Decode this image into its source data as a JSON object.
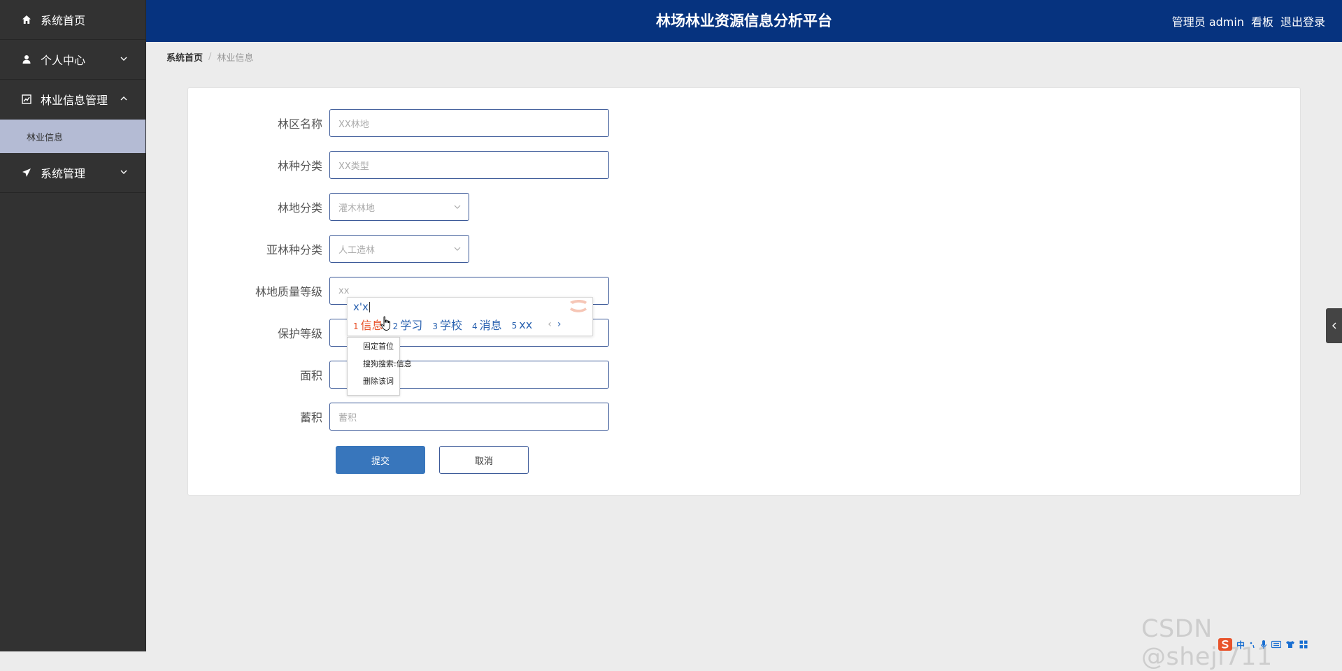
{
  "app": {
    "title": "林场林业资源信息分析平台",
    "header_links": {
      "user": "管理员 admin",
      "dashboard": "看板",
      "logout": "退出登录"
    }
  },
  "sidebar": {
    "items": [
      {
        "label": "系统首页",
        "icon": "home-icon"
      },
      {
        "label": "个人中心",
        "icon": "user-icon",
        "expanded": false
      },
      {
        "label": "林业信息管理",
        "icon": "chart-icon",
        "expanded": true,
        "children": [
          {
            "label": "林业信息"
          }
        ]
      },
      {
        "label": "系统管理",
        "icon": "send-icon",
        "expanded": false
      }
    ]
  },
  "breadcrumb": {
    "home": "系统首页",
    "separator": "/",
    "current": "林业信息"
  },
  "form": {
    "fields": [
      {
        "label": "林区名称",
        "type": "input",
        "placeholder": "XX林地",
        "value": ""
      },
      {
        "label": "林种分类",
        "type": "input",
        "placeholder": "XX类型",
        "value": ""
      },
      {
        "label": "林地分类",
        "type": "select",
        "selected": "灌木林地"
      },
      {
        "label": "亚林种分类",
        "type": "select",
        "selected": "人工造林"
      },
      {
        "label": "林地质量等级",
        "type": "input",
        "placeholder": "",
        "value": "xx"
      },
      {
        "label": "保护等级",
        "type": "input",
        "placeholder": "",
        "value": ""
      },
      {
        "label": "面积",
        "type": "input",
        "placeholder": "",
        "value": ""
      },
      {
        "label": "蓄积",
        "type": "input",
        "placeholder": "蓄积",
        "value": ""
      }
    ],
    "submit_label": "提交",
    "cancel_label": "取消"
  },
  "ime": {
    "pinyin": "x'x",
    "candidates": [
      {
        "num": "1",
        "text": "信息"
      },
      {
        "num": "2",
        "text": "学习"
      },
      {
        "num": "3",
        "text": "学校"
      },
      {
        "num": "4",
        "text": "消息"
      },
      {
        "num": "5",
        "text": "xx"
      }
    ],
    "prev_page": "‹",
    "next_page": "›",
    "context_menu": [
      "固定首位",
      "搜狗搜索:信息",
      "删除该词"
    ],
    "taskbar_lang": "中"
  },
  "watermark": "CSDN @sheji711",
  "colors": {
    "header_bg": "#06337f",
    "sidebar_bg": "#323232",
    "submenu_active_bg": "#b4bbd4",
    "submit_bg": "#3876bc",
    "ime_active": "#e8532b"
  }
}
